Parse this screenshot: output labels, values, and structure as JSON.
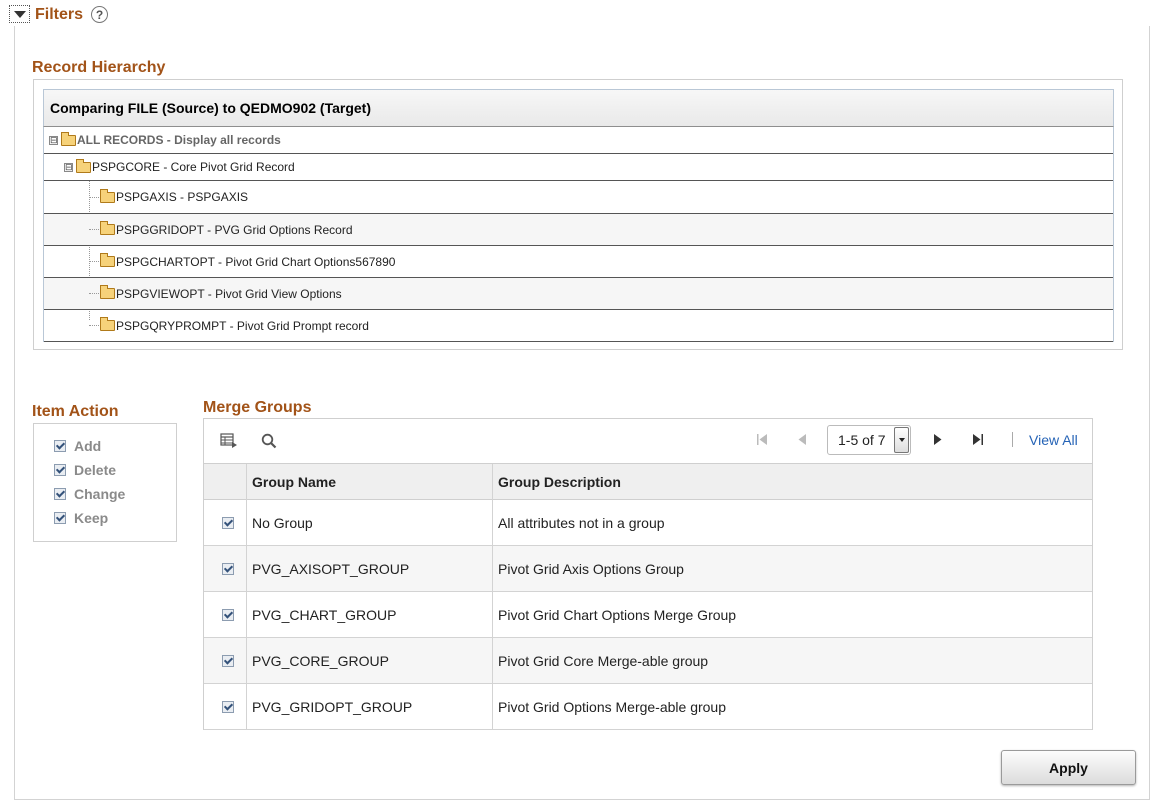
{
  "filters": {
    "title": "Filters",
    "help_glyph": "?",
    "collapse_icon": "triangle-down-icon"
  },
  "record_hierarchy": {
    "title": "Record Hierarchy",
    "header": "Comparing FILE (Source) to QEDMO902 (Target)",
    "nodes": [
      {
        "label": "ALL RECORDS - Display all records",
        "level": 0,
        "expander": "⊟"
      },
      {
        "label": "PSPGCORE - Core Pivot Grid Record",
        "level": 1,
        "expander": "⊟"
      },
      {
        "label": "PSPGAXIS - PSPGAXIS",
        "level": 2
      },
      {
        "label": "PSPGGRIDOPT - PVG Grid Options Record",
        "level": 2
      },
      {
        "label": "PSPGCHARTOPT - Pivot Grid Chart Options567890",
        "level": 2
      },
      {
        "label": "PSPGVIEWOPT - Pivot Grid View Options",
        "level": 2
      },
      {
        "label": "PSPGQRYPROMPT - Pivot Grid Prompt record",
        "level": 2
      }
    ]
  },
  "item_action": {
    "title": "Item Action",
    "items": [
      {
        "label": "Add",
        "checked": true
      },
      {
        "label": "Delete",
        "checked": true
      },
      {
        "label": "Change",
        "checked": true
      },
      {
        "label": "Keep",
        "checked": true
      }
    ]
  },
  "merge_groups": {
    "title": "Merge Groups",
    "pagination": {
      "range": "1-5 of 7",
      "view_all": "View All"
    },
    "toolbar_icons": [
      "personalize-grid-icon",
      "search-icon",
      "first-page-icon",
      "previous-page-icon",
      "next-page-icon",
      "last-page-icon"
    ],
    "columns": [
      "Group Name",
      "Group Description"
    ],
    "rows": [
      {
        "checked": true,
        "name": "No Group",
        "description": "All attributes not in a group"
      },
      {
        "checked": true,
        "name": "PVG_AXISOPT_GROUP",
        "description": "Pivot Grid Axis Options Group"
      },
      {
        "checked": true,
        "name": "PVG_CHART_GROUP",
        "description": "Pivot Grid Chart Options Merge Group"
      },
      {
        "checked": true,
        "name": "PVG_CORE_GROUP",
        "description": "Pivot Grid Core Merge-able group"
      },
      {
        "checked": true,
        "name": "PVG_GRIDOPT_GROUP",
        "description": "Pivot Grid Options Merge-able group"
      }
    ]
  },
  "actions": {
    "apply_label": "Apply"
  },
  "colors": {
    "section_title": "#a25318",
    "link": "#2563b6"
  }
}
